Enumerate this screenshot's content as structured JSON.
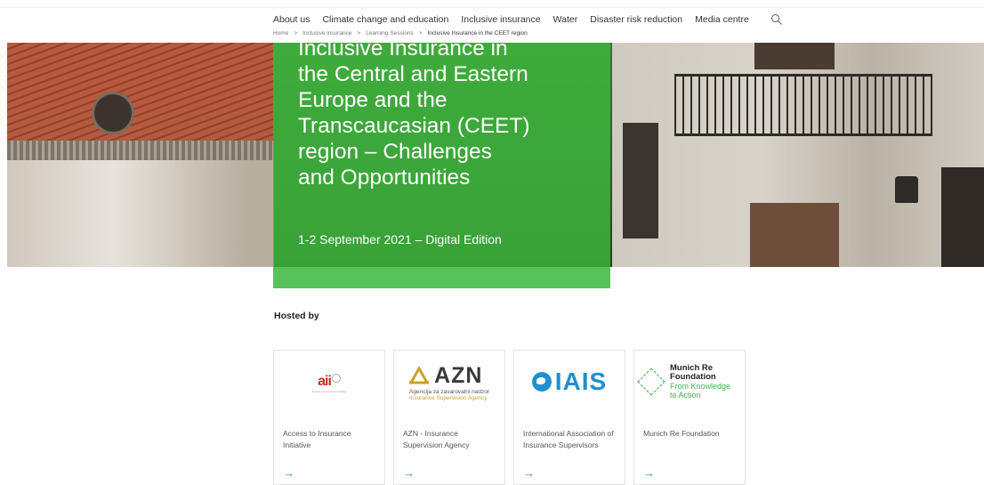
{
  "nav": {
    "items": [
      {
        "label": "About us"
      },
      {
        "label": "Climate change and education"
      },
      {
        "label": "Inclusive insurance"
      },
      {
        "label": "Water"
      },
      {
        "label": "Disaster risk reduction"
      },
      {
        "label": "Media centre"
      }
    ],
    "search_icon": "search-icon"
  },
  "breadcrumb": {
    "items": [
      "Home",
      ">",
      "Inclusive insurance",
      ">",
      "Learning Sessions",
      ">"
    ],
    "current": "Inclusive Insurance in the CEET region"
  },
  "hero": {
    "title_lines": [
      "Inclusive Insurance in",
      "the Central and Eastern",
      "Europe and the",
      "Transcaucasian (CEET)",
      "region – Challenges",
      "and Opportunities"
    ],
    "date": "1-2 September 2021 – Digital Edition",
    "panel_color": "#3cba3c"
  },
  "hosted": {
    "label": "Hosted by",
    "cards": [
      {
        "name": "Access to Insurance Initiative",
        "logo": {
          "text": "aii",
          "sub": "Access to Insurance Initiative"
        },
        "arrow": "→"
      },
      {
        "name": "AZN - Insurance Supervision Agency",
        "logo": {
          "text": "AZN",
          "sub1": "Agencija za zavarovalni nadzor",
          "sub2": "Insurance Supervision Agency"
        },
        "arrow": "→"
      },
      {
        "name": "International Association of Insurance Supervisors",
        "logo": {
          "text": "IAIS"
        },
        "arrow": "→"
      },
      {
        "name": "Munich Re Foundation",
        "logo": {
          "line1": "Munich Re",
          "line2": "Foundation",
          "line3": "From Knowledge",
          "line4": "to Action"
        },
        "arrow": "→"
      }
    ]
  },
  "colors": {
    "accent_green": "#3cba3c",
    "link_blue": "#2a8fd6"
  }
}
